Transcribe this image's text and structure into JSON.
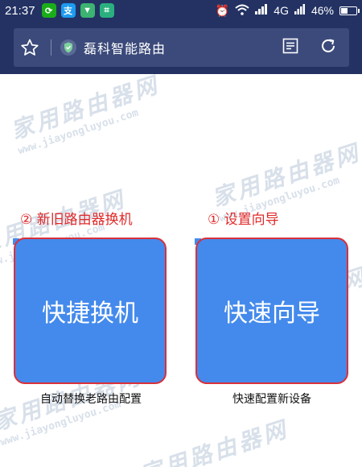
{
  "status_bar": {
    "time": "21:37",
    "network": "4G",
    "battery": "46%",
    "battery_level": 0.46,
    "apps": [
      {
        "icon": "wechat-like-icon",
        "color": "#1aad19",
        "glyph": "⟳"
      },
      {
        "icon": "alipay-icon",
        "color": "#1d9bf0",
        "glyph": "支"
      },
      {
        "icon": "shield-app-icon",
        "color": "#3cb371",
        "glyph": "▼"
      },
      {
        "icon": "scan-app-icon",
        "color": "#2ab07f",
        "glyph": "⌗"
      }
    ]
  },
  "toolbar": {
    "title": "磊科智能路由"
  },
  "watermark": {
    "cn": "家用路由器网",
    "en": "www.jiayongluyou.com"
  },
  "main": {
    "left": {
      "section_label": "② 新旧路由器换机",
      "tile_label": "快捷换机",
      "caption": "自动替换老路由配置"
    },
    "right": {
      "section_label": "① 设置向导",
      "tile_label": "快速向导",
      "caption": "快速配置新设备"
    }
  },
  "colors": {
    "header": "#233263",
    "tile": "#448aec",
    "annotation": "#e02a2a"
  }
}
